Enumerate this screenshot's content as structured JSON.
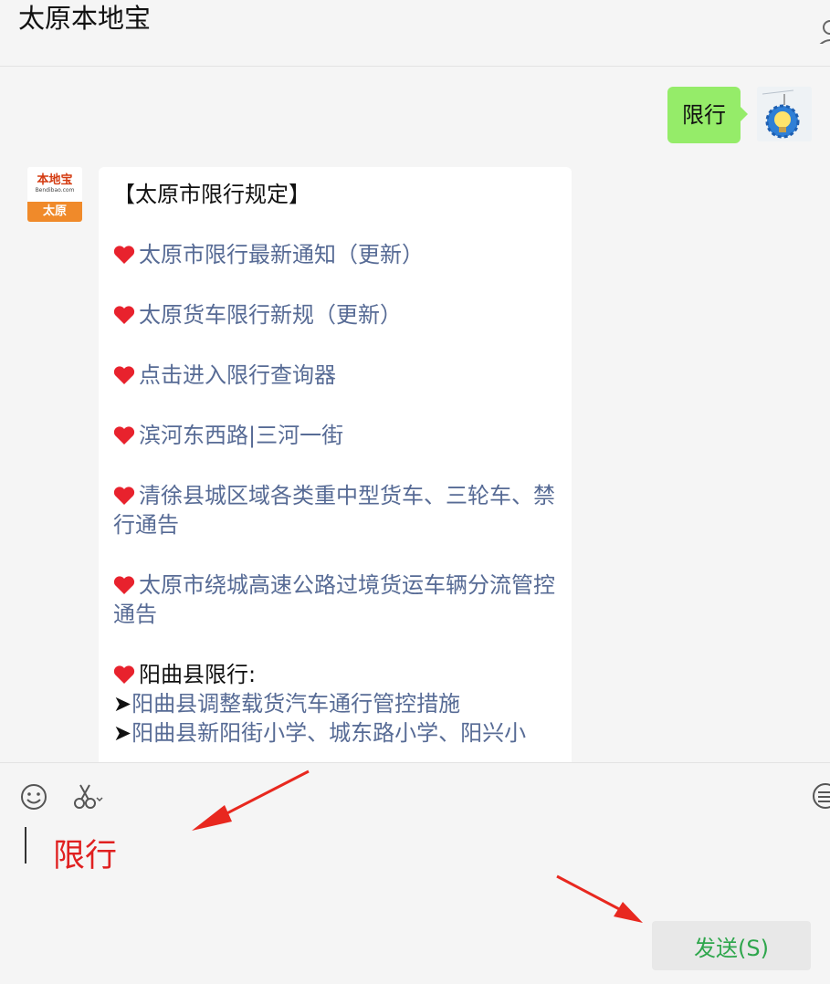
{
  "header": {
    "title": "太原本地宝",
    "right_icon": "person-icon"
  },
  "chat": {
    "user_message": "限行",
    "bot_avatar": {
      "brand": "本地宝",
      "domain": "Bendibao.com",
      "city": "太原"
    },
    "bot_message": {
      "heading": "【太原市限行规定】",
      "items": [
        {
          "icon": "heart-icon",
          "text": "太原市限行最新通知（更新）"
        },
        {
          "icon": "heart-icon",
          "text": "太原货车限行新规（更新）"
        },
        {
          "icon": "heart-icon",
          "text": "点击进入限行查询器"
        },
        {
          "icon": "heart-icon",
          "text": "滨河东西路|三河一街"
        },
        {
          "icon": "heart-icon",
          "text": "清徐县城区域各类重中型货车、三轮车、禁行通告"
        },
        {
          "icon": "heart-icon",
          "text": "太原市绕城高速公路过境货运车辆分流管控通告"
        }
      ],
      "section": {
        "icon": "heart-icon",
        "title": "阳曲县限行:",
        "lines": [
          {
            "marker": "➤",
            "text": "阳曲县调整载货汽车通行管控措施"
          },
          {
            "marker": "➤",
            "text": "阳曲县新阳街小学、城东路小学、阳兴小"
          }
        ]
      }
    }
  },
  "composer": {
    "tools": [
      "emoji-icon",
      "scissors-icon",
      "chat-history-icon"
    ],
    "input_text": "限行",
    "send_label": "发送(S)"
  },
  "colors": {
    "user_bubble": "#95ec69",
    "link": "#576b95",
    "send_text": "#2ea64c",
    "annotation": "#e02020"
  }
}
